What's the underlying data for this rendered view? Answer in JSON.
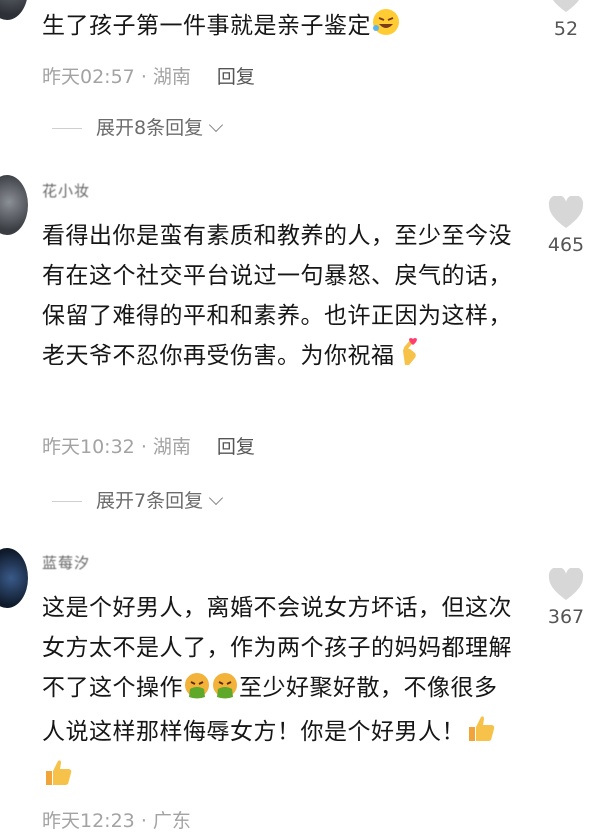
{
  "comments": [
    {
      "text": "生了孩子第一件事就是亲子鉴定",
      "time": "昨天02:57",
      "location": "湖南",
      "reply_label": "回复",
      "expand_label": "展开8条回复",
      "likes": "52"
    },
    {
      "username": "花小妆",
      "text": "看得出你是蛮有素质和教养的人，至少至今没有在这个社交平台说过一句暴怒、戾气的话，保留了难得的平和和素养。也许正因为这样，老天爷不忍你再受伤害。为你祝福",
      "time": "昨天10:32",
      "location": "湖南",
      "reply_label": "回复",
      "expand_label": "展开7条回复",
      "likes": "465"
    },
    {
      "username": "蓝莓汐",
      "text_a": "这是个好男人，离婚不会说女方坏话，但这次女方太不是人了，作为两个孩子的妈妈都理解不了这个操作",
      "text_b": "至少好聚好散，不像很多人说这样那样侮辱女方！你是个好男人！",
      "time": "昨天12:23",
      "location": "广东",
      "likes": "367"
    }
  ],
  "separator": "·",
  "icons": {
    "like": "heart-icon",
    "laugh_emoji": "rolling-laughing-emoji",
    "heart_hand_emoji": "finger-heart-emoji",
    "vomit_emoji": "vomiting-face-emoji",
    "thumbs_emoji": "thumbs-up-emoji"
  },
  "colors": {
    "text": "#161616",
    "meta": "#a3a3a3",
    "heart": "#d7d7d7"
  }
}
